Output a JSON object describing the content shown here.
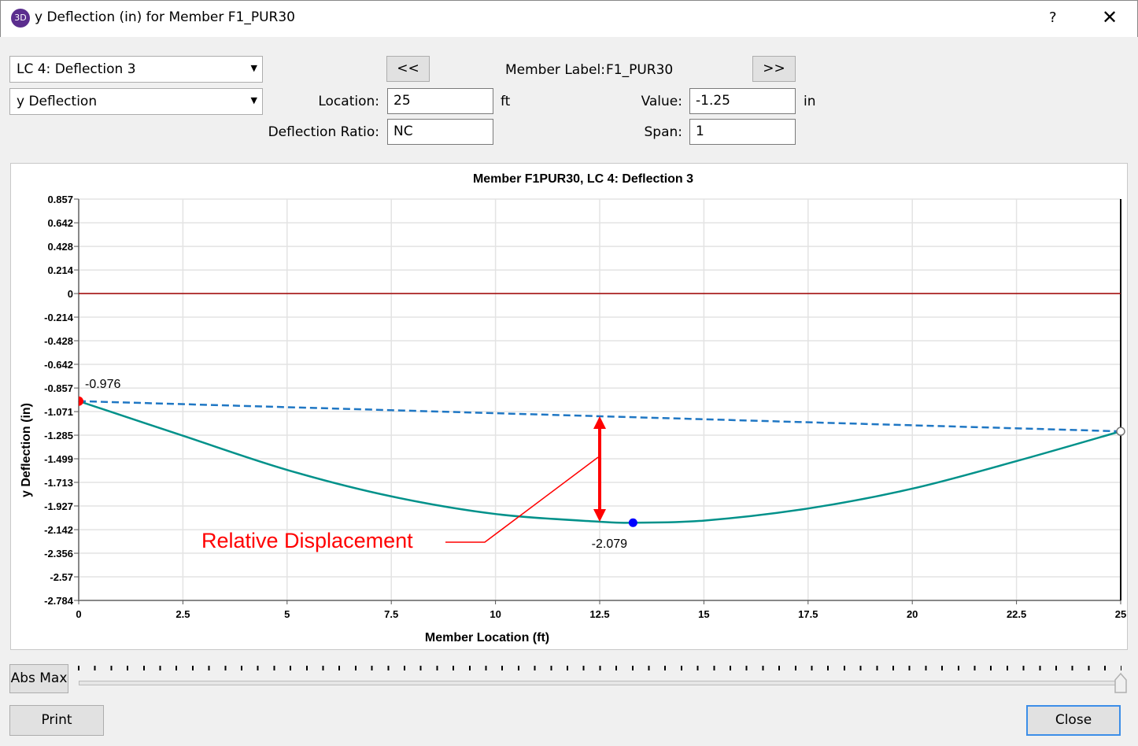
{
  "window": {
    "title": "y Deflection (in) for Member F1_PUR30",
    "icon": "3D",
    "help": "?",
    "close": "✕"
  },
  "controls": {
    "load_case": "LC 4: Deflection 3",
    "result_type": "y Deflection",
    "prev_label": "<<",
    "next_label": ">>",
    "member_label_caption": "Member Label:",
    "member_label": "F1_PUR30",
    "location_caption": "Location:",
    "location": "25",
    "location_unit": "ft",
    "value_caption": "Value:",
    "value": "-1.25",
    "value_unit": "in",
    "ratio_caption": "Deflection Ratio:",
    "ratio": "NC",
    "span_caption": "Span:",
    "span": "1"
  },
  "slider": {
    "abs_max_label": "Abs Max",
    "position": 1.0
  },
  "footer": {
    "print_label": "Print",
    "close_label": "Close"
  },
  "chart_data": {
    "type": "line",
    "title": "Member F1PUR30, LC 4: Deflection 3",
    "xlabel": "Member Location (ft)",
    "ylabel": "y Deflection (in)",
    "xlim": [
      0,
      25
    ],
    "ylim": [
      -2.784,
      0.857
    ],
    "xticks": [
      "0",
      "2.5",
      "5",
      "7.5",
      "10",
      "12.5",
      "15",
      "17.5",
      "20",
      "22.5",
      "25"
    ],
    "yticks": [
      "0.857",
      "0.642",
      "0.428",
      "0.214",
      "0",
      "-0.214",
      "-0.428",
      "-0.642",
      "-0.857",
      "-1.071",
      "-1.285",
      "-1.499",
      "-1.713",
      "-1.927",
      "-2.142",
      "-2.356",
      "-2.57",
      "-2.784"
    ],
    "grid": true,
    "colors": {
      "deflection": "#00918a",
      "chord": "#1f77c4",
      "zero": "#a00000",
      "max_point": "#0000ff",
      "annotation": "#ff0000"
    },
    "deflection": {
      "x": [
        0,
        2.5,
        5,
        7.5,
        10,
        12.5,
        13.3,
        15,
        17.5,
        20,
        22.5,
        25
      ],
      "y": [
        -0.976,
        -1.29,
        -1.6,
        -1.84,
        -2.0,
        -2.07,
        -2.079,
        -2.06,
        -1.95,
        -1.77,
        -1.52,
        -1.25
      ]
    },
    "chord": {
      "x": [
        0,
        25
      ],
      "y": [
        -0.976,
        -1.25
      ]
    },
    "labels": {
      "start": "-0.976",
      "max": "-2.079",
      "max_x": 13.3
    },
    "annotation": {
      "text": "Relative Displacement",
      "x": 12.5
    }
  }
}
